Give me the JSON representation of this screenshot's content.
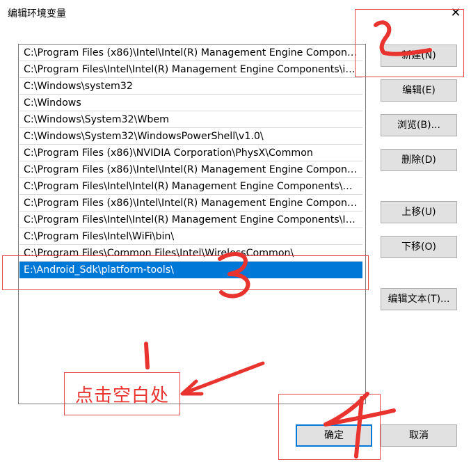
{
  "window": {
    "title": "编辑环境变量",
    "close_glyph": "✕"
  },
  "path_list": {
    "items": [
      "C:\\Program Files (x86)\\Intel\\Intel(R) Management Engine Compon…",
      "C:\\Program Files\\Intel\\Intel(R) Management Engine Components\\i…",
      "C:\\Windows\\system32",
      "C:\\Windows",
      "C:\\Windows\\System32\\Wbem",
      "C:\\Windows\\System32\\WindowsPowerShell\\v1.0\\",
      "C:\\Program Files (x86)\\NVIDIA Corporation\\PhysX\\Common",
      "C:\\Program Files (x86)\\Intel\\Intel(R) Management Engine Compon…",
      "C:\\Program Files\\Intel\\Intel(R) Management Engine Components\\…",
      "C:\\Program Files (x86)\\Intel\\Intel(R) Management Engine Compon…",
      "C:\\Program Files\\Intel\\Intel(R) Management Engine Components\\I…",
      "C:\\Program Files\\Intel\\WiFi\\bin\\",
      "C:\\Program Files\\Common Files\\Intel\\WirelessCommon\\",
      "E:\\Android_Sdk\\platform-tools\\"
    ],
    "selected_index": 13
  },
  "buttons": {
    "new": "新建(N)",
    "edit": "编辑(E)",
    "browse": "浏览(B)...",
    "delete": "删除(D)",
    "move_up": "上移(U)",
    "move_down": "下移(O)",
    "edit_text": "编辑文本(T)...",
    "ok": "确定",
    "cancel": "取消"
  },
  "annotations": {
    "hint_text": "点击空白处",
    "numbers": [
      "1",
      "2",
      "3",
      "4"
    ],
    "color": "#e8332e"
  },
  "colors": {
    "selection": "#0078d7",
    "button_face": "#e1e1e1"
  }
}
